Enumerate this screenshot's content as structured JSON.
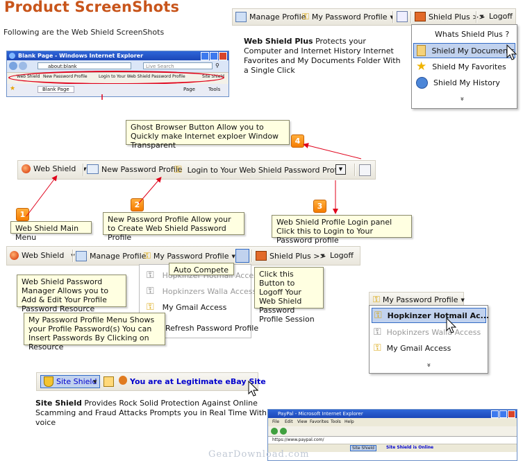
{
  "page": {
    "title": "Product ScreenShots",
    "intro": "Following are the Web Shield ScreenShots",
    "watermark": "GearDownload.com"
  },
  "ie_window": {
    "title": "Blank Page - Windows Internet Explorer",
    "address": "about:blank",
    "search_placeholder": "Live Search",
    "toolbar": [
      "Web Shield",
      "New Password Profile",
      "Login to Your Web Shield Password Profile",
      "Site Shield"
    ],
    "tab": "Blank Page",
    "page_label": "Page",
    "tools_label": "Tools"
  },
  "top_toolbar": {
    "manage": "Manage Profile",
    "my_password": "My Password Profile",
    "shield_plus": "Shield Plus >>",
    "logoff": "Logoff"
  },
  "shield_plus_menu": {
    "items": [
      "Whats Shield Plus ?",
      "Shield My Documents",
      "Shield My Favorites",
      "Shield My History"
    ],
    "more": "»"
  },
  "shield_plus_desc": {
    "bold": "Web Shield Plus",
    "text": " Protects your Computer and Internet History Internet Favorites and My Documents Folder With a Single Click"
  },
  "ghost_note": "Ghost Browser Button Allow you to Quickly make Internet exploer Window Transparent",
  "main_toolbar": {
    "web_shield": "Web Shield",
    "new_profile": "New Password Profile",
    "login": "Login to Your Web Shield Password Profile"
  },
  "numbers": [
    "1",
    "2",
    "3",
    "4"
  ],
  "notes": {
    "main_menu": "Web Shield Main Menu",
    "new_profile": "New Password Profile Allow your to Create Web Shield Password Profile",
    "login_panel": "Web Shield Profile Login panel Click this to Login to Your Password profile",
    "manager": "Web Shield Password Manager Allows you to Add & Edit Your Profile Password Resource",
    "profile_menu": "My Password Profile Menu Shows your Profile Password(s) You can Insert Passwords By Clicking on Resource",
    "logoff": "Click this Button to Logoff Your Web Shield Password Profile Session",
    "auto_compete": "Auto Compete"
  },
  "second_toolbar": {
    "web_shield": "Web Shield",
    "manage": "Manage Profile",
    "my_password": "My Password Profile",
    "shield_plus": "Shield Plus >>",
    "logoff": "Logoff"
  },
  "profile_menu_left": {
    "items": [
      "Hopkinzer Hotmail Access",
      "Hopkinzers Walla Access",
      "My Gmail Access",
      "Refresh Password Profile"
    ]
  },
  "profile_menu_right": {
    "header": "My Password Profile",
    "items": [
      "Hopkinzer Hotmail Ac...",
      "Hopkinzers Walla Access",
      "My Gmail Access"
    ],
    "more": "»"
  },
  "site_shield": {
    "button": "Site Shield",
    "status": "You are at Legitimate eBay Site",
    "desc_bold": "Site Shield",
    "desc_text": " Provides Rock Solid Protection Against Online Scamming and Fraud Attacks Prompts you in Real Time With voice"
  },
  "paypal_window": {
    "title": "PayPal - Microsoft Internet Explorer",
    "menu": [
      "File",
      "Edit",
      "View",
      "Favorites",
      "Tools",
      "Help"
    ],
    "address": "https://www.paypal.com/",
    "toolbar_item": "Site Shield",
    "status": "Site Shield is Online"
  },
  "colors": {
    "title": "#c8551b",
    "note_bg": "#ffffe1",
    "number_badge": "#f57c00",
    "arrow": "#e0001a",
    "link_blue": "#0000cc",
    "highlight": "#c1d2ee"
  }
}
